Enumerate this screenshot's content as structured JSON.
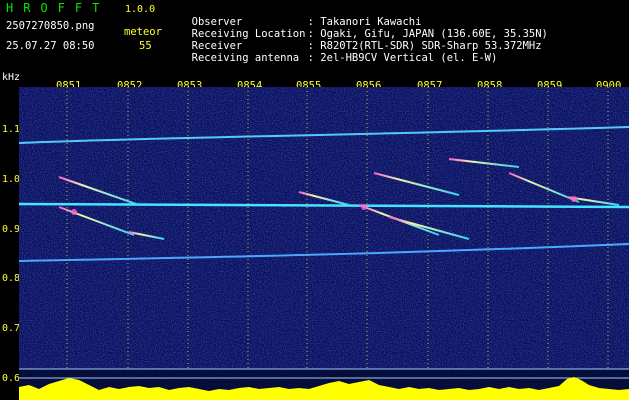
{
  "header": {
    "app_title": "HROFFT",
    "app_version": "1.0.0",
    "file_name": "2507270850.png",
    "datetime": "25.07.27 08:50",
    "meteor_label": "meteor",
    "meteor_count": "55"
  },
  "info": [
    {
      "label": "Observer",
      "value": ": Takanori Kawachi"
    },
    {
      "label": "Receiving Location",
      "value": ": Ogaki, Gifu, JAPAN (136.60E, 35.35N)"
    },
    {
      "label": "Receiver",
      "value": ": R820T2(RTL-SDR) SDR-Sharp 53.372MHz"
    },
    {
      "label": "Receiving antenna",
      "value": ": 2el-HB9CV Vertical (el. E-W)"
    }
  ],
  "axes": {
    "y_unit": "kHz",
    "time_ticks": [
      "0851",
      "0852",
      "0853",
      "0854",
      "0855",
      "0856",
      "0857",
      "0858",
      "0859",
      "0900"
    ],
    "freq_ticks": [
      "1.1",
      "1.0",
      "0.9",
      "0.8",
      "0.7",
      "0.6"
    ]
  },
  "colors": {
    "accent_green": "#00e600",
    "label_yellow": "#ffff33",
    "background": "#000000",
    "spectrogram_bg": "#0a1060"
  }
}
